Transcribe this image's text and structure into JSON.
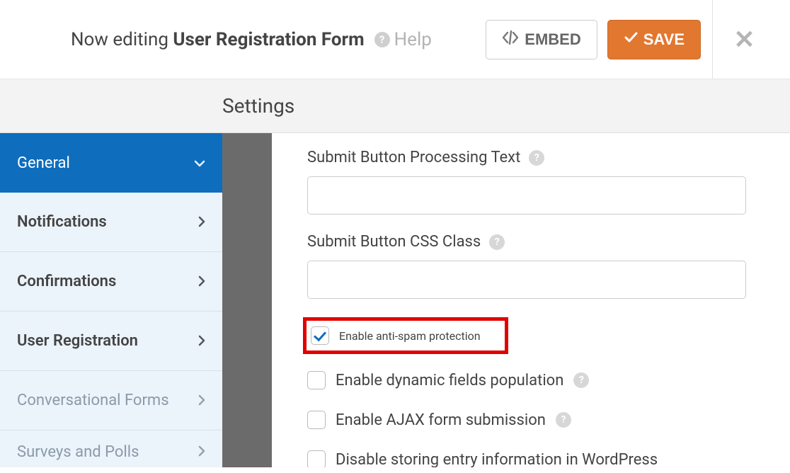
{
  "topbar": {
    "prefix": "Now editing ",
    "title": "User Registration Form",
    "help_label": "Help",
    "embed_label": "EMBED",
    "save_label": "SAVE"
  },
  "strip": {
    "title": "Settings"
  },
  "sidebar": {
    "items": [
      {
        "label": "General",
        "active": true,
        "chev": "down"
      },
      {
        "label": "Notifications",
        "chev": "right"
      },
      {
        "label": "Confirmations",
        "chev": "right"
      },
      {
        "label": "User Registration",
        "chev": "right"
      },
      {
        "label": "Conversational Forms",
        "chev": "right",
        "muted": true
      },
      {
        "label": "Surveys and Polls",
        "chev": "right",
        "muted": true
      }
    ]
  },
  "panel": {
    "field_submit_processing": {
      "label": "Submit Button Processing Text",
      "value": ""
    },
    "field_submit_css": {
      "label": "Submit Button CSS Class",
      "value": ""
    },
    "check_antispam": {
      "label": "Enable anti-spam protection",
      "checked": true
    },
    "check_dynamic": {
      "label": "Enable dynamic fields population",
      "checked": false
    },
    "check_ajax": {
      "label": "Enable AJAX form submission",
      "checked": false
    },
    "check_disable_store": {
      "label": "Disable storing entry information in WordPress",
      "checked": false
    }
  }
}
